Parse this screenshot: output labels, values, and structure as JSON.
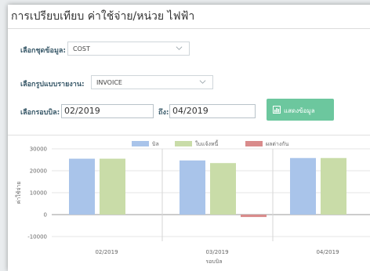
{
  "title": "การเปรียบเทียบ ค่าใช้จ่าย/หน่วย ไฟฟ้า",
  "filters": {
    "data_label": "เลือกชุดข้อมูล:",
    "data_value": "COST",
    "report_label": "เลือกรูปแบบรายงาน:",
    "report_value": "INVOICE",
    "period_label": "เลือกรอบบิล:",
    "from_value": "02/2019",
    "to_label": "ถึง:",
    "to_value": "04/2019",
    "show_button": "แสดงข้อมูล"
  },
  "colors": {
    "accent": "#6cc79e",
    "bill": "#a9c4ea",
    "paid": "#c9dca8",
    "diff": "#d98b8b"
  },
  "chart_data": {
    "type": "bar",
    "categories": [
      "02/2019",
      "03/2019",
      "04/2019"
    ],
    "series": [
      {
        "name": "บิล",
        "values": [
          25500,
          24700,
          25800
        ]
      },
      {
        "name": "ใบแจ้งหนี้",
        "values": [
          25500,
          23500,
          25800
        ]
      },
      {
        "name": "ผลต่างกัน",
        "values": [
          0,
          -1100,
          0
        ]
      }
    ],
    "ylim": [
      -10000,
      30000
    ],
    "yticks": [
      -10000,
      0,
      10000,
      20000,
      30000
    ],
    "ylabel": "ค่าใช้จ่าย",
    "xlabel": "รอบบิล",
    "legend": "top"
  }
}
